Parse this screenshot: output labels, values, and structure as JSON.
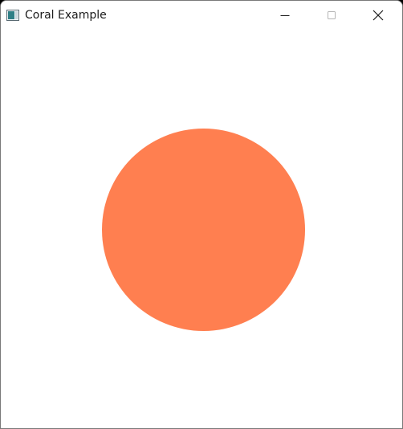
{
  "window": {
    "title": "Coral Example",
    "app_icon": "window-app-icon",
    "controls": {
      "minimize_icon": "minimize-icon",
      "maximize_icon": "maximize-icon",
      "close_icon": "close-icon"
    }
  },
  "canvas": {
    "background": "#ffffff",
    "shape": "circle",
    "shape_color": "#ff7f50"
  }
}
